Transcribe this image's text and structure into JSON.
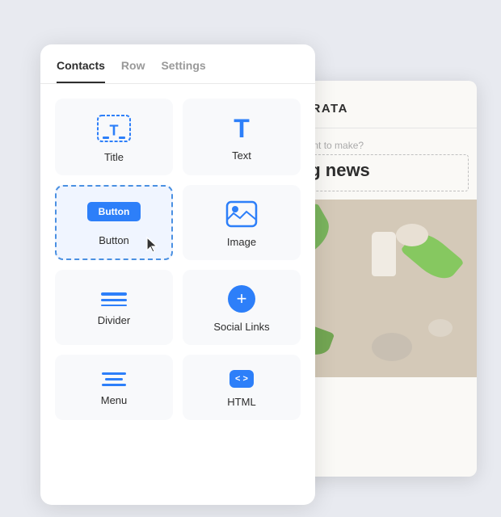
{
  "tabs": [
    {
      "id": "contacts",
      "label": "Contacts",
      "active": true
    },
    {
      "id": "row",
      "label": "Row",
      "active": false
    },
    {
      "id": "settings",
      "label": "Settings",
      "active": false
    }
  ],
  "grid_items": [
    {
      "id": "title",
      "label": "Title",
      "icon": "title-icon"
    },
    {
      "id": "text",
      "label": "Text",
      "icon": "text-icon"
    },
    {
      "id": "button",
      "label": "Button",
      "icon": "button-icon",
      "selected": true,
      "preview_label": "Button"
    },
    {
      "id": "image",
      "label": "Image",
      "icon": "image-icon"
    },
    {
      "id": "divider",
      "label": "Divider",
      "icon": "divider-icon"
    },
    {
      "id": "social-links",
      "label": "Social Links",
      "icon": "social-icon"
    },
    {
      "id": "menu",
      "label": "Menu",
      "icon": "menu-icon"
    },
    {
      "id": "html",
      "label": "HTML",
      "icon": "html-icon"
    }
  ],
  "email_preview": {
    "brand_name": "PRATA",
    "announcement": "ouncement to make?",
    "headline": "r big news"
  },
  "colors": {
    "accent": "#2d7ff9",
    "selected_border": "#4a90e2",
    "text_dark": "#2d2d2d",
    "tab_inactive": "#999999"
  }
}
